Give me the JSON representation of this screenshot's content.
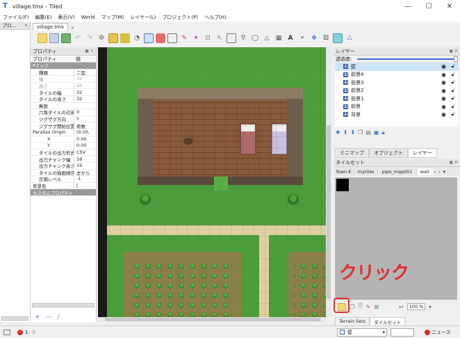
{
  "window": {
    "title": "village.tmx - Tiled",
    "minimize": "—",
    "maximize": "☐",
    "close": "✕"
  },
  "menu": [
    "ファイル(F)",
    "編集(E)",
    "表示(V)",
    "World",
    "マップ(M)",
    "レイヤー(L)",
    "プロジェクト(P)",
    "ヘルプ(H)"
  ],
  "left_dock": {
    "title": "プロ..."
  },
  "document_tab": "village.tmx",
  "properties": {
    "title": "プロパティ",
    "header_key": "プロパティ",
    "header_value": "値",
    "group_map": "マップ",
    "rows": [
      {
        "k": "種類",
        "v": "二型",
        "grey": false
      },
      {
        "k": "幅",
        "v": "32",
        "grey": true
      },
      {
        "k": "高さ",
        "v": "20",
        "grey": true
      },
      {
        "k": "タイルの幅",
        "v": "32",
        "grey": false
      },
      {
        "k": "タイルの高さ",
        "v": "32",
        "grey": false
      },
      {
        "k": "無限",
        "v": "",
        "grey": false
      },
      {
        "k": "六角タイルの辺長",
        "v": "0",
        "grey": false
      },
      {
        "k": "ジグザグ方向",
        "v": "Y",
        "grey": false
      },
      {
        "k": "ジグザグ開始位置",
        "v": "奇数",
        "grey": false
      },
      {
        "k": "Parallax Origin",
        "v": "(0.00,",
        "grey": false
      },
      {
        "k": "X",
        "v": "0.00",
        "grey": false
      },
      {
        "k": "Y",
        "v": "0.00",
        "grey": false
      },
      {
        "k": "タイルの出力形式",
        "v": "CSV",
        "grey": false
      },
      {
        "k": "出力チャンク幅",
        "v": "16",
        "grey": false
      },
      {
        "k": "出力チャンク高さ",
        "v": "16",
        "grey": false
      },
      {
        "k": "タイルの描画順序",
        "v": "左から",
        "grey": false
      },
      {
        "k": "圧縮レベル",
        "v": "-1",
        "grey": false
      },
      {
        "k": "背景色",
        "v": "[",
        "grey": false
      }
    ],
    "group_custom": "カスタムプロパティ"
  },
  "layers": {
    "title": "レイヤー",
    "opacity_label": "透過度:",
    "items": [
      "壁",
      "前景4",
      "前景3",
      "前景2",
      "前景1",
      "前景",
      "背景"
    ],
    "tabs": [
      "ミニマップ",
      "オブジェクト",
      "レイヤー"
    ]
  },
  "tilesets": {
    "title": "タイルセット",
    "tabs": [
      "Town-E",
      "mytiles",
      "pipo_map001",
      "wall"
    ],
    "zoom": "100 %",
    "bottom_tabs": [
      "Terrain Sets",
      "タイルセット"
    ]
  },
  "annotation": "クリック",
  "statusbar": {
    "layer": "壁",
    "news": "ニュース",
    "errors": "1",
    "warnings": "0"
  },
  "colors": {
    "grass": "#4c9e3c",
    "floor": "#8a5a3c",
    "wall": "#7a6a58",
    "path": "#e0cfa0",
    "annotation": "#e03030"
  }
}
